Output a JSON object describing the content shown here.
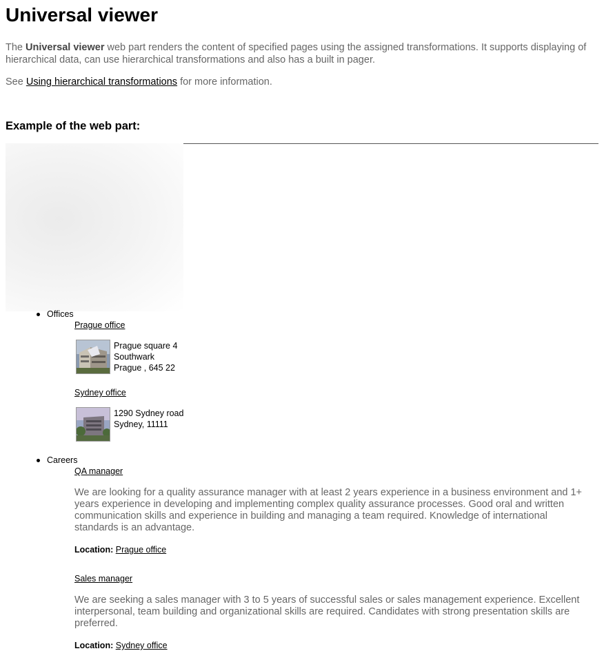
{
  "page_title": "Universal viewer",
  "intro": {
    "p1_bold": "Universal viewer",
    "p1_rest": " web part renders the content of specified pages using the assigned transformations. It supports displaying of hierarchical data, can use hierarchical transformations and also has a built in pager.",
    "p1_prefix": "The ",
    "p2_prefix": "See ",
    "p2_link": "Using hierarchical transformations",
    "p2_suffix": " for more information."
  },
  "section_heading": "Example of the web part:",
  "tree": {
    "offices": {
      "label": "Offices",
      "items": [
        {
          "link": "Prague office",
          "image_icon": "office-building-photo",
          "address_lines": [
            "Prague square 4",
            "Southwark",
            "Prague , 645 22"
          ]
        },
        {
          "link": "Sydney office",
          "image_icon": "office-building-photo",
          "address_lines": [
            "1290 Sydney road",
            "Sydney, 11111"
          ]
        }
      ]
    },
    "careers": {
      "label": "Careers",
      "items": [
        {
          "link": "QA manager",
          "description": "We are looking for a quality assurance manager with at least 2 years experience in a business environment and 1+ years experience in developing and implementing complex quality assurance processes. Good oral and written communication skills and experience in building and managing a team required. Knowledge of international standards is an advantage.",
          "location_label": "Location:",
          "location_link": "Prague office"
        },
        {
          "link": "Sales manager",
          "description": "We are seeking a sales manager with 3 to 5 years of successful sales or sales management experience. Excellent interpersonal, team building and organizational skills are required. Candidates with strong presentation skills are preferred.",
          "location_label": "Location:",
          "location_link": "Sydney office"
        }
      ]
    }
  },
  "colors": {
    "text": "#000000",
    "muted_text": "#666666",
    "separator": "#555555"
  }
}
